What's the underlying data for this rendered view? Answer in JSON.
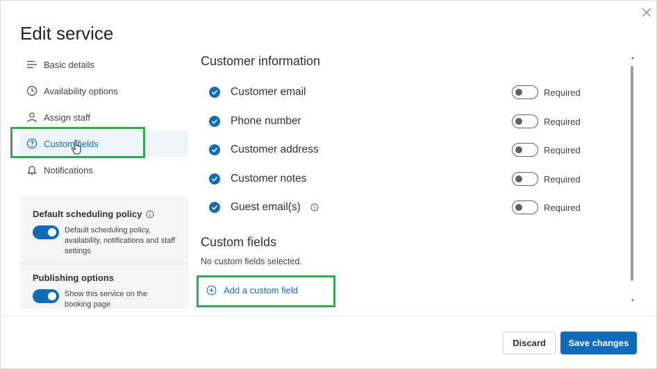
{
  "dialog": {
    "title": "Edit service",
    "close_icon": "close-icon"
  },
  "sidebar": {
    "items": [
      {
        "label": "Basic details",
        "icon": "lines-icon"
      },
      {
        "label": "Availability options",
        "icon": "clock-icon"
      },
      {
        "label": "Assign staff",
        "icon": "person-icon"
      },
      {
        "label": "Custom fields",
        "icon": "question-circle-icon",
        "active": true
      },
      {
        "label": "Notifications",
        "icon": "bell-icon"
      }
    ],
    "default_policy": {
      "title": "Default scheduling policy",
      "enabled": true,
      "description": "Default scheduling policy, availability, notifications and staff settings"
    },
    "publishing": {
      "title": "Publishing options",
      "enabled": true,
      "description": "Show this service on the booking page"
    }
  },
  "customer_info": {
    "title": "Customer information",
    "required_label": "Required",
    "fields": [
      {
        "label": "Customer email",
        "checked": true,
        "required": false
      },
      {
        "label": "Phone number",
        "checked": true,
        "required": false
      },
      {
        "label": "Customer address",
        "checked": true,
        "required": false
      },
      {
        "label": "Customer notes",
        "checked": true,
        "required": false
      },
      {
        "label": "Guest email(s)",
        "checked": true,
        "required": false,
        "has_info": true
      }
    ]
  },
  "custom_fields": {
    "title": "Custom fields",
    "empty_text": "No custom fields selected.",
    "add_label": "Add a custom field"
  },
  "footer": {
    "discard_label": "Discard",
    "save_label": "Save changes"
  },
  "colors": {
    "accent": "#0f6cbd",
    "highlight": "#2eab4a"
  }
}
